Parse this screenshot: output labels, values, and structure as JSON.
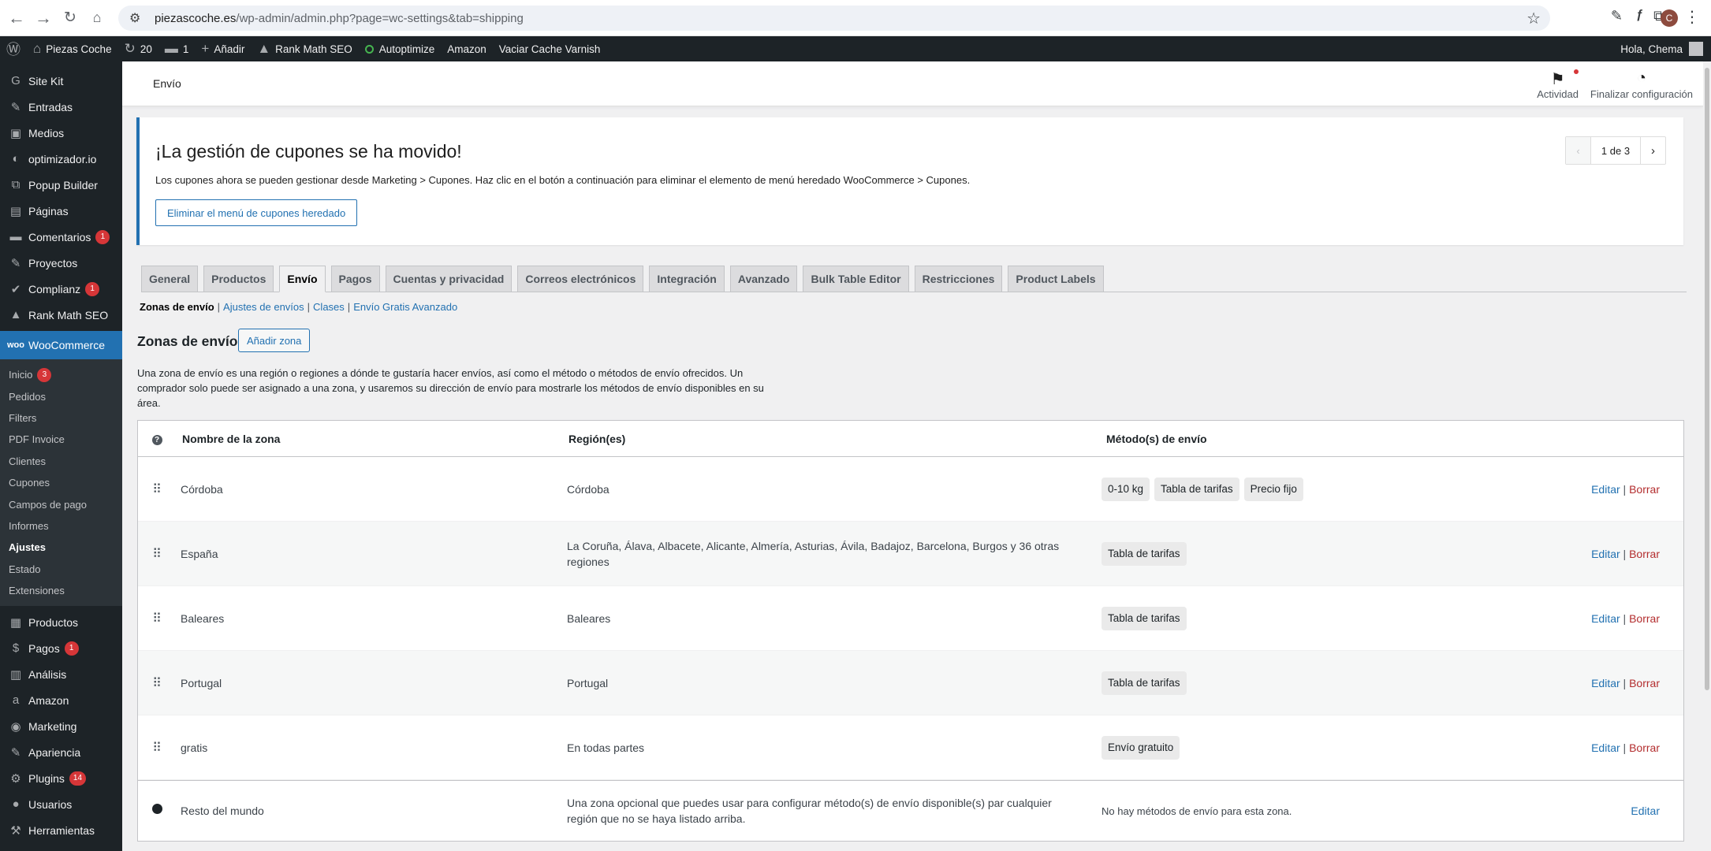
{
  "browser": {
    "url_host": "piezascoche.es",
    "url_path": "/wp-admin/admin.php?page=wc-settings&tab=shipping",
    "profile_initial": "C"
  },
  "adminbar": {
    "site_name": "Piezas Coche",
    "updates_count": "20",
    "comments_count": "1",
    "new_label": "Añadir",
    "rankmath_label": "Rank Math SEO",
    "autoptimize_label": "Autoptimize",
    "amazon_label": "Amazon",
    "varnish_label": "Vaciar Cache Varnish",
    "greeting": "Hola, Chema"
  },
  "sidebar": {
    "top_items": [
      {
        "label": "Site Kit",
        "icon": "G"
      },
      {
        "label": "Entradas",
        "icon": "✎",
        "badge": ""
      },
      {
        "label": "Medios",
        "icon": "▣"
      },
      {
        "label": "optimizador.io",
        "icon": "◐"
      },
      {
        "label": "Popup Builder",
        "icon": "⧉"
      },
      {
        "label": "Páginas",
        "icon": "▤"
      },
      {
        "label": "Comentarios",
        "icon": "▬",
        "badge": "1"
      },
      {
        "label": "Proyectos",
        "icon": "✎"
      },
      {
        "label": "Complianz",
        "icon": "✔",
        "badge": "1"
      },
      {
        "label": "Rank Math SEO",
        "icon": "▲"
      }
    ],
    "woocommerce_label": "WooCommerce",
    "woo_subitems": [
      {
        "label": "Inicio",
        "badge": "3"
      },
      {
        "label": "Pedidos"
      },
      {
        "label": "Filters"
      },
      {
        "label": "PDF Invoice"
      },
      {
        "label": "Clientes"
      },
      {
        "label": "Cupones"
      },
      {
        "label": "Campos de pago"
      },
      {
        "label": "Informes"
      },
      {
        "label": "Ajustes"
      },
      {
        "label": "Estado"
      },
      {
        "label": "Extensiones"
      }
    ],
    "bottom_items": [
      {
        "label": "Productos",
        "icon": "▦"
      },
      {
        "label": "Pagos",
        "icon": "$",
        "badge": "1"
      },
      {
        "label": "Análisis",
        "icon": "▥"
      },
      {
        "label": "Amazon",
        "icon": "a"
      },
      {
        "label": "Marketing",
        "icon": "◉"
      },
      {
        "label": "Apariencia",
        "icon": "✎"
      },
      {
        "label": "Plugins",
        "icon": "⚙",
        "badge": "14"
      },
      {
        "label": "Usuarios",
        "icon": "●"
      },
      {
        "label": "Herramientas",
        "icon": "⚒"
      }
    ]
  },
  "header": {
    "title": "Envío",
    "activity_label": "Actividad",
    "finish_label": "Finalizar configuración"
  },
  "notice": {
    "title": "¡La gestión de cupones se ha movido!",
    "text": "Los cupones ahora se pueden gestionar desde Marketing > Cupones. Haz clic en el botón a continuación para eliminar el elemento de menú heredado WooCommerce > Cupones.",
    "button": "Eliminar el menú de cupones heredado",
    "pager": "1 de 3"
  },
  "tabs": [
    "General",
    "Productos",
    "Envío",
    "Pagos",
    "Cuentas y privacidad",
    "Correos electrónicos",
    "Integración",
    "Avanzado",
    "Bulk Table Editor",
    "Restricciones",
    "Product Labels"
  ],
  "active_tab": "Envío",
  "subnav": [
    "Zonas de envío",
    "Ajustes de envíos",
    "Clases",
    "Envío Gratis Avanzado"
  ],
  "zones": {
    "title": "Zonas de envío",
    "add_button": "Añadir zona",
    "description": "Una zona de envío es una región o regiones a dónde te gustaría hacer envíos, así como el método o métodos de envío ofrecidos. Un comprador solo puede ser asignado a una zona, y usaremos su dirección de envío para mostrarle los métodos de envío disponibles en su área.",
    "headers": {
      "name": "Nombre de la zona",
      "regions": "Región(es)",
      "methods": "Método(s) de envío"
    },
    "rows": [
      {
        "name": "Córdoba",
        "regions": "Córdoba",
        "methods": [
          "0-10 kg",
          "Tabla de tarifas",
          "Precio fijo"
        ]
      },
      {
        "name": "España",
        "regions": "La Coruña, Álava, Albacete, Alicante, Almería, Asturias, Ávila, Badajoz, Barcelona, Burgos y 36 otras regiones",
        "methods": [
          "Tabla de tarifas"
        ]
      },
      {
        "name": "Baleares",
        "regions": "Baleares",
        "methods": [
          "Tabla de tarifas"
        ]
      },
      {
        "name": "Portugal",
        "regions": "Portugal",
        "methods": [
          "Tabla de tarifas"
        ]
      },
      {
        "name": "gratis",
        "regions": "En todas partes",
        "methods": [
          "Envío gratuito"
        ]
      }
    ],
    "edit_label": "Editar",
    "delete_label": "Borrar",
    "rest": {
      "name": "Resto del mundo",
      "regions": "Una zona opcional que puedes usar para configurar método(s) de envío disponible(s) par cualquier región que no se haya listado arriba.",
      "methods": "No hay métodos de envío para esta zona.",
      "edit_label": "Editar"
    }
  }
}
